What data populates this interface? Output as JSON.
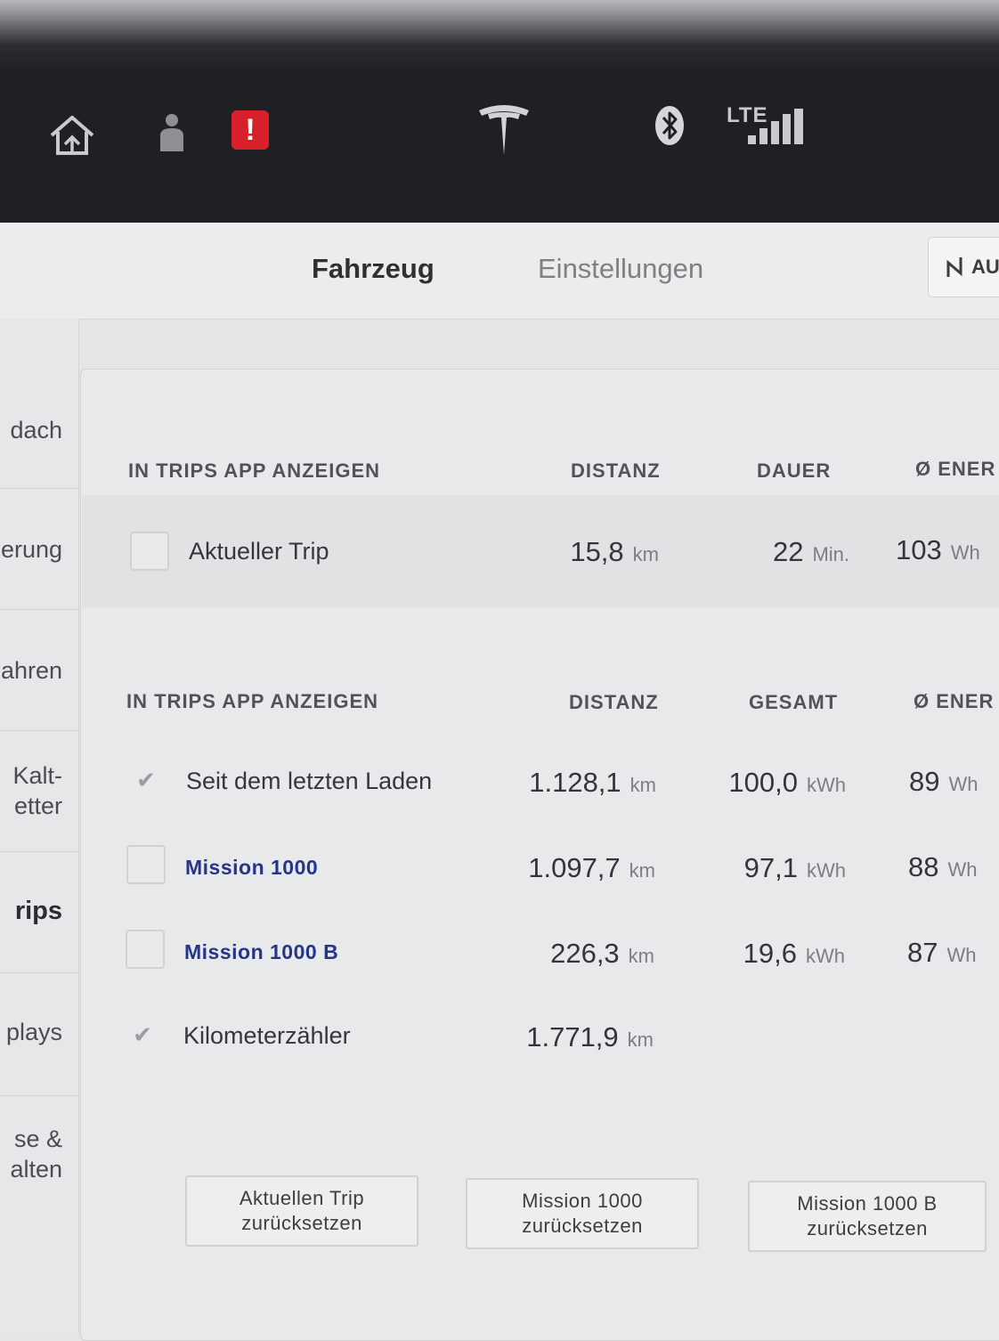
{
  "status_bar": {
    "network_label": "LTE",
    "alert_glyph": "!",
    "icons": [
      "home-icon",
      "driver-profile-icon",
      "alert-icon",
      "tesla-logo",
      "bluetooth-icon",
      "signal-strength-icon"
    ],
    "colors": {
      "alert": "#d8202a",
      "bar_bg": "#1f2023"
    }
  },
  "tabs": {
    "vehicle": "Fahrzeug",
    "settings": "Einstellungen"
  },
  "auto_button": {
    "label": "AU",
    "icon": "bolt-icon"
  },
  "sidebar": {
    "items": [
      {
        "label": "dach"
      },
      {
        "label": "erung"
      },
      {
        "label": "ahren"
      },
      {
        "label": "Kalt-\netter"
      },
      {
        "label": "rips",
        "active": true
      },
      {
        "label": "plays"
      },
      {
        "label": "se &\nalten"
      }
    ]
  },
  "current_trip": {
    "header": {
      "show": "IN TRIPS APP ANZEIGEN",
      "distance": "DISTANZ",
      "duration": "DAUER",
      "energy": "Ø ENER"
    },
    "row": {
      "name": "Aktueller Trip",
      "checked": false,
      "distance": "15,8",
      "distance_unit": "km",
      "duration": "22",
      "duration_unit": "Min.",
      "energy": "103",
      "energy_unit": "Wh"
    }
  },
  "trips": {
    "header": {
      "show": "IN TRIPS APP ANZEIGEN",
      "distance": "DISTANZ",
      "total": "GESAMT",
      "energy": "Ø ENER"
    },
    "rows": [
      {
        "name": "Seit dem letzten Laden",
        "checked": true,
        "distance": "1.128,1",
        "distance_unit": "km",
        "total": "100,0",
        "total_unit": "kWh",
        "energy": "89",
        "energy_unit": "Wh"
      },
      {
        "name": "Mission 1000",
        "checked": false,
        "distance": "1.097,7",
        "distance_unit": "km",
        "total": "97,1",
        "total_unit": "kWh",
        "energy": "88",
        "energy_unit": "Wh"
      },
      {
        "name": "Mission 1000 B",
        "checked": false,
        "distance": "226,3",
        "distance_unit": "km",
        "total": "19,6",
        "total_unit": "kWh",
        "energy": "87",
        "energy_unit": "Wh"
      },
      {
        "name": "Kilometerzähler",
        "checked": true,
        "distance": "1.771,9",
        "distance_unit": "km"
      }
    ],
    "check_glyph": "✔"
  },
  "buttons": {
    "reset_current": {
      "line1": "Aktuellen Trip",
      "line2": "zurücksetzen"
    },
    "reset_m1000": {
      "line1": "Mission 1000",
      "line2": "zurücksetzen"
    },
    "reset_m1000b": {
      "line1": "Mission 1000 B",
      "line2": "zurücksetzen"
    }
  }
}
